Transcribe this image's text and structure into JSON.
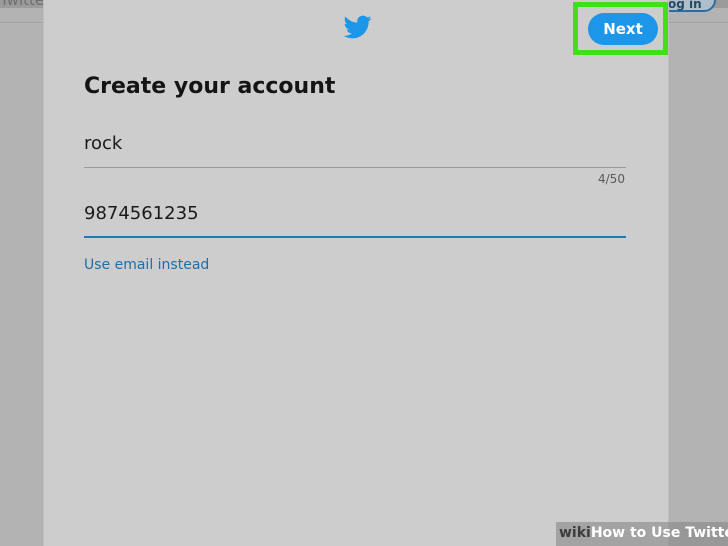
{
  "background": {
    "left_text": "Twitter",
    "right_button": "Log in"
  },
  "modal": {
    "title": "Create your account",
    "next_label": "Next",
    "name_value": "rock",
    "name_counter": "4/50",
    "phone_value": "9874561235",
    "use_email_link": "Use email instead"
  },
  "icons": {
    "logo": "twitter-bird-icon"
  },
  "colors": {
    "accent": "#1b96e8",
    "highlight": "#40e017",
    "link": "#1f6ea6"
  },
  "watermark": {
    "wiki": "wiki",
    "rest": "How to Use Twitter"
  }
}
